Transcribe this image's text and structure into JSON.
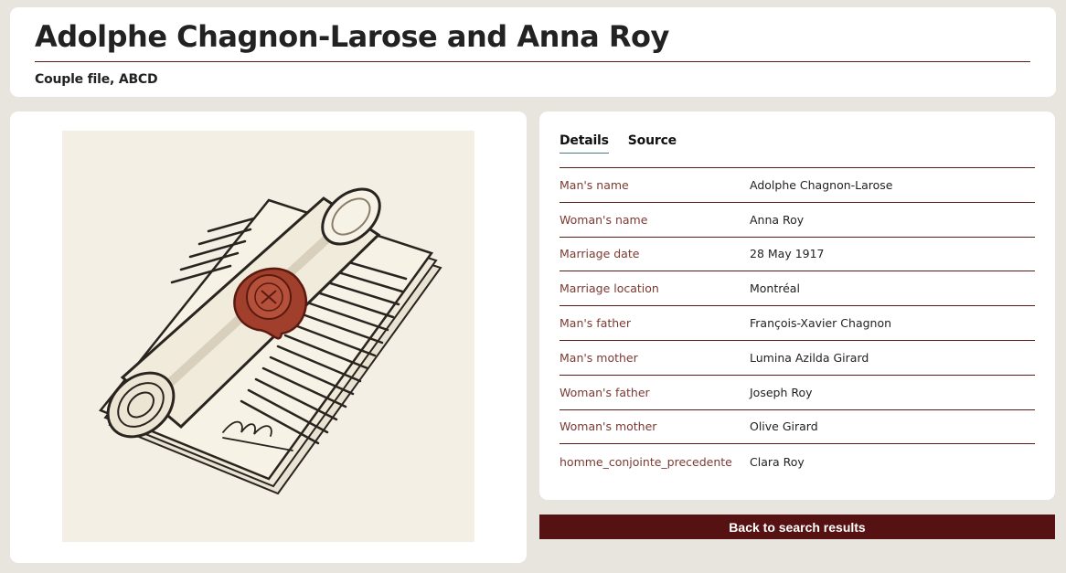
{
  "header": {
    "title": "Adolphe Chagnon-Larose and Anna Roy",
    "subtitle": "Couple file, ABCD"
  },
  "tabs": [
    {
      "label": "Details",
      "active": true
    },
    {
      "label": "Source",
      "active": false
    }
  ],
  "details": [
    {
      "label": "Man's name",
      "value": "Adolphe Chagnon-Larose"
    },
    {
      "label": "Woman's name",
      "value": "Anna Roy"
    },
    {
      "label": "Marriage date",
      "value": "28 May 1917"
    },
    {
      "label": "Marriage location",
      "value": "Montréal"
    },
    {
      "label": "Man's father",
      "value": "François-Xavier Chagnon"
    },
    {
      "label": "Man's mother",
      "value": "Lumina Azilda Girard"
    },
    {
      "label": "Woman's father",
      "value": "Joseph Roy"
    },
    {
      "label": "Woman's mother",
      "value": "Olive Girard"
    },
    {
      "label": "homme_conjointe_precedente",
      "value": "Clara Roy"
    }
  ],
  "actions": {
    "back_label": "Back to search results"
  },
  "colors": {
    "page_background": "#e8e5de",
    "accent": "#561212",
    "label_text": "#7a3a32",
    "illustration_background": "#f3efe4",
    "wax_seal": "#a0402c"
  }
}
